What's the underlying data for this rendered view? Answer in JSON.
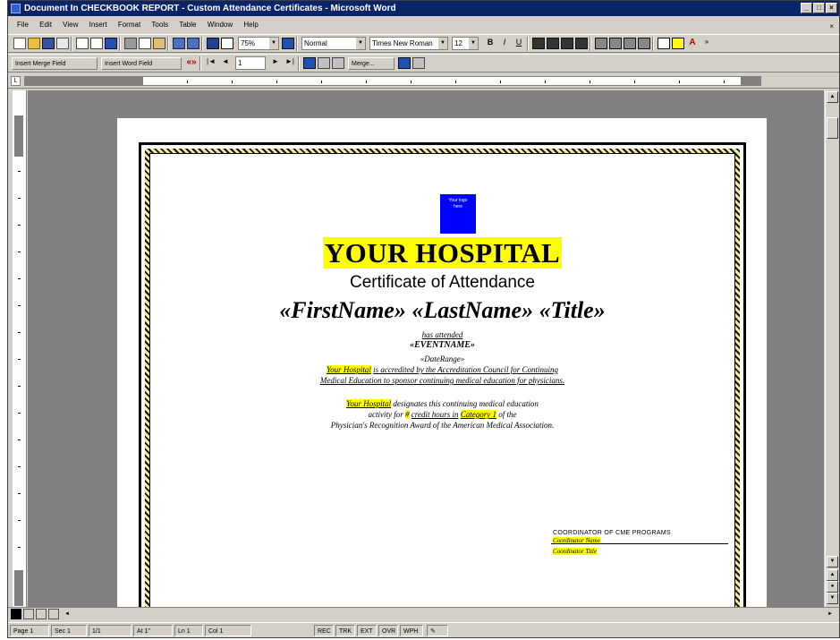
{
  "window": {
    "title": "Document In CHECKBOOK REPORT - Custom Attendance Certificates - Microsoft Word",
    "min_label": "_",
    "max_label": "□",
    "close_label": "×"
  },
  "menu": [
    "File",
    "Edit",
    "View",
    "Insert",
    "Format",
    "Tools",
    "Table",
    "Window",
    "Help"
  ],
  "toolbar": {
    "zoom": "75%",
    "style": "Normal",
    "font": "Times New Roman",
    "size": "12",
    "insert_merge_field": "Insert Merge Field",
    "insert_word_field": "Insert Word Field",
    "record": "1",
    "merge": "Merge..."
  },
  "certificate": {
    "logo_text": "Your logo here",
    "hospital": "YOUR HOSPITAL",
    "subtitle": "Certificate of Attendance",
    "merge_names": "«FirstName» «LastName» «Title»",
    "attended": "has attended",
    "event_name": "«EVENTNAME»",
    "date_range": "«DateRange»",
    "accred_hl": "Your Hospital",
    "accred_rest": "is accredited by the Accreditation Council for Continuing",
    "accred_line2": "Medical Education to sponsor continuing medical education for physicians.",
    "desig_hl": "Your Hospital",
    "desig_rest": "designates this continuing medical education",
    "desig_line2a": "activity for",
    "desig_line2_hl1": "#",
    "desig_line2b": "credit hours in",
    "desig_line2_hl2": "Category 1",
    "desig_line2c": "of the",
    "desig_line3": "Physician's Recognition Award of the American Medical Association.",
    "sig_title": "COORDINATOR OF CME PROGRAMS",
    "sig_name": "Coordinator Name",
    "sig_role": "Coordinator Title"
  },
  "status": {
    "page": "Page 1",
    "sec": "Sec 1",
    "pages": "1/1",
    "at": "At 1\"",
    "ln": "Ln 1",
    "col": "Col 1",
    "rec": "REC",
    "trk": "TRK",
    "ext": "EXT",
    "ovr": "OVR",
    "wph": "WPH"
  }
}
